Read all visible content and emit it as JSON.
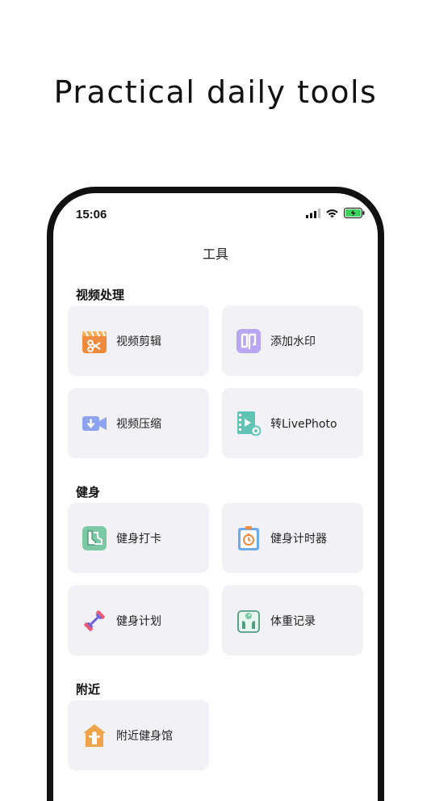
{
  "headline": "Practical daily tools",
  "status_bar": {
    "time": "15:06"
  },
  "nav": {
    "title": "工具"
  },
  "sections": [
    {
      "title": "视频处理",
      "items": [
        {
          "label": "视频剪辑",
          "icon": "scissors-clapper-icon"
        },
        {
          "label": "添加水印",
          "icon": "stamp-icon"
        },
        {
          "label": "视频压缩",
          "icon": "video-download-icon"
        },
        {
          "label": "转LivePhoto",
          "icon": "film-strip-icon"
        }
      ]
    },
    {
      "title": "健身",
      "items": [
        {
          "label": "健身打卡",
          "icon": "sneakers-icon"
        },
        {
          "label": "健身计时器",
          "icon": "stopwatch-clipboard-icon"
        },
        {
          "label": "健身计划",
          "icon": "dumbbell-icon"
        },
        {
          "label": "体重记录",
          "icon": "scale-icon"
        }
      ]
    },
    {
      "title": "附近",
      "items": [
        {
          "label": "附近健身馆",
          "icon": "gym-house-icon"
        }
      ]
    }
  ],
  "colors": {
    "card_bg": "#f2f2f6",
    "orange": "#f08a3c",
    "purple": "#b9a6f2",
    "blue": "#8ea3f0",
    "teal": "#5fc4b3",
    "green": "#7bc8a4",
    "battery": "#3ecf5e"
  }
}
